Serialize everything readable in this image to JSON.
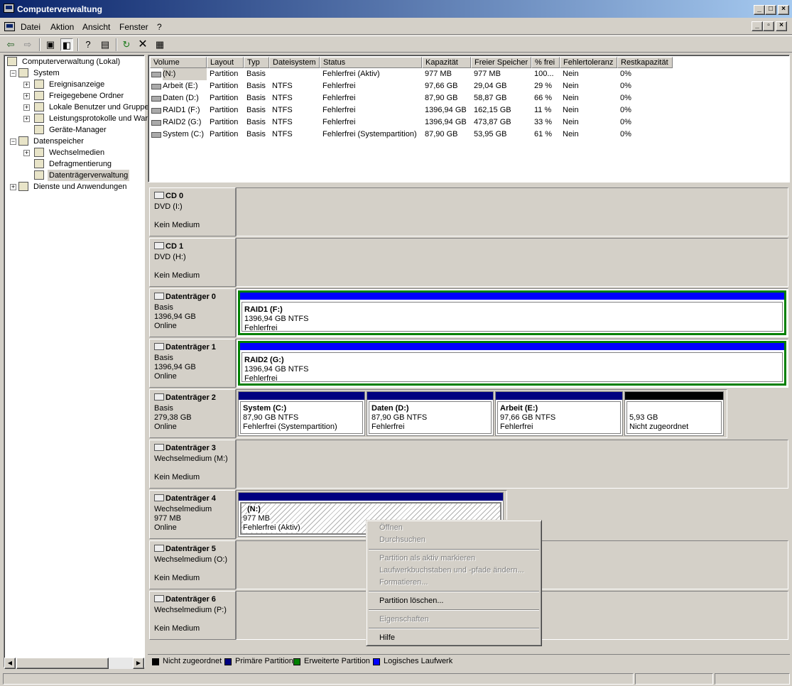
{
  "window": {
    "title": "Computerverwaltung"
  },
  "menu": [
    "Datei",
    "Aktion",
    "Ansicht",
    "Fenster",
    "?"
  ],
  "tree": [
    {
      "label": "Computerverwaltung (Lokal)",
      "icon": "computer-icon"
    },
    {
      "label": "System",
      "icon": "tools-icon"
    },
    {
      "label": "Ereignisanzeige",
      "icon": "event-viewer-icon"
    },
    {
      "label": "Freigegebene Ordner",
      "icon": "shared-folder-icon"
    },
    {
      "label": "Lokale Benutzer und Gruppe",
      "icon": "users-icon"
    },
    {
      "label": "Leistungsprotokolle und War",
      "icon": "performance-icon"
    },
    {
      "label": "Geräte-Manager",
      "icon": "device-manager-icon"
    },
    {
      "label": "Datenspeicher",
      "icon": "storage-icon"
    },
    {
      "label": "Wechselmedien",
      "icon": "removable-media-icon"
    },
    {
      "label": "Defragmentierung",
      "icon": "defrag-icon"
    },
    {
      "label": "Datenträgerverwaltung",
      "icon": "disk-management-icon"
    },
    {
      "label": "Dienste und Anwendungen",
      "icon": "services-icon"
    }
  ],
  "volumes": {
    "columns": [
      "Volume",
      "Layout",
      "Typ",
      "Dateisystem",
      "Status",
      "Kapazität",
      "Freier Speicher",
      "% frei",
      "Fehlertoleranz",
      "Restkapazität"
    ],
    "rows": [
      [
        "(N:)",
        "Partition",
        "Basis",
        "",
        "Fehlerfrei (Aktiv)",
        "977 MB",
        "977 MB",
        "100...",
        "Nein",
        "0%"
      ],
      [
        "Arbeit (E:)",
        "Partition",
        "Basis",
        "NTFS",
        "Fehlerfrei",
        "97,66 GB",
        "29,04 GB",
        "29 %",
        "Nein",
        "0%"
      ],
      [
        "Daten (D:)",
        "Partition",
        "Basis",
        "NTFS",
        "Fehlerfrei",
        "87,90 GB",
        "58,87 GB",
        "66 %",
        "Nein",
        "0%"
      ],
      [
        "RAID1 (F:)",
        "Partition",
        "Basis",
        "NTFS",
        "Fehlerfrei",
        "1396,94 GB",
        "162,15 GB",
        "11 %",
        "Nein",
        "0%"
      ],
      [
        "RAID2 (G:)",
        "Partition",
        "Basis",
        "NTFS",
        "Fehlerfrei",
        "1396,94 GB",
        "473,87 GB",
        "33 %",
        "Nein",
        "0%"
      ],
      [
        "System (C:)",
        "Partition",
        "Basis",
        "NTFS",
        "Fehlerfrei (Systempartition)",
        "87,90 GB",
        "53,95 GB",
        "61 %",
        "Nein",
        "0%"
      ]
    ]
  },
  "disks": [
    {
      "name": "CD 0",
      "l1": "DVD (I:)",
      "l2": "",
      "l3": "Kein Medium",
      "icon": "cd-icon"
    },
    {
      "name": "CD 1",
      "l1": "DVD (H:)",
      "l2": "",
      "l3": "Kein Medium",
      "icon": "cd-icon"
    },
    {
      "name": "Datenträger 0",
      "l1": "Basis",
      "l2": "1396,94 GB",
      "l3": "Online",
      "icon": "hard-disk-icon",
      "parts": [
        {
          "title": "RAID1  (F:)",
          "size": "1396,94 GB NTFS",
          "status": "Fehlerfrei"
        }
      ]
    },
    {
      "name": "Datenträger 1",
      "l1": "Basis",
      "l2": "1396,94 GB",
      "l3": "Online",
      "icon": "hard-disk-icon",
      "parts": [
        {
          "title": "RAID2  (G:)",
          "size": "1396,94 GB NTFS",
          "status": "Fehlerfrei"
        }
      ]
    },
    {
      "name": "Datenträger 2",
      "l1": "Basis",
      "l2": "279,38 GB",
      "l3": "Online",
      "icon": "hard-disk-icon",
      "parts": [
        {
          "title": "System  (C:)",
          "size": "87,90 GB NTFS",
          "status": "Fehlerfrei (Systempartition)"
        },
        {
          "title": "Daten  (D:)",
          "size": "87,90 GB NTFS",
          "status": "Fehlerfrei"
        },
        {
          "title": "Arbeit  (E:)",
          "size": "97,66 GB NTFS",
          "status": "Fehlerfrei"
        },
        {
          "title": "",
          "size": "5,93 GB",
          "status": "Nicht zugeordnet"
        }
      ]
    },
    {
      "name": "Datenträger 3",
      "l1": "Wechselmedium (M:)",
      "l2": "",
      "l3": "Kein Medium",
      "icon": "removable-disk-icon"
    },
    {
      "name": "Datenträger 4",
      "l1": "Wechselmedium",
      "l2": "977 MB",
      "l3": "Online",
      "icon": "removable-disk-icon",
      "parts": [
        {
          "title": "(N:)",
          "size": "977 MB",
          "status": "Fehlerfrei (Aktiv)"
        }
      ]
    },
    {
      "name": "Datenträger 5",
      "l1": "Wechselmedium (O:)",
      "l2": "",
      "l3": "Kein Medium",
      "icon": "removable-disk-icon"
    },
    {
      "name": "Datenträger 6",
      "l1": "Wechselmedium (P:)",
      "l2": "",
      "l3": "Kein Medium",
      "icon": "removable-disk-icon"
    }
  ],
  "legend": [
    {
      "label": "Nicht zugeordnet",
      "color": "#000000"
    },
    {
      "label": "Primäre Partition",
      "color": "#000080"
    },
    {
      "label": "Erweiterte Partition",
      "color": "#008000"
    },
    {
      "label": "Logisches Laufwerk",
      "color": "#0000ff"
    }
  ],
  "context_menu": [
    "Öffnen",
    "Durchsuchen",
    "Partition als aktiv markieren",
    "Laufwerkbuchstaben und -pfade ändern...",
    "Formatieren...",
    "Partition löschen...",
    "Eigenschaften",
    "Hilfe"
  ],
  "colors": {
    "primary": "#000080",
    "extended": "#008000",
    "logical": "#0000ff",
    "unallocated": "#000000",
    "title_start": "#0a246a",
    "title_end": "#a6caf0"
  }
}
